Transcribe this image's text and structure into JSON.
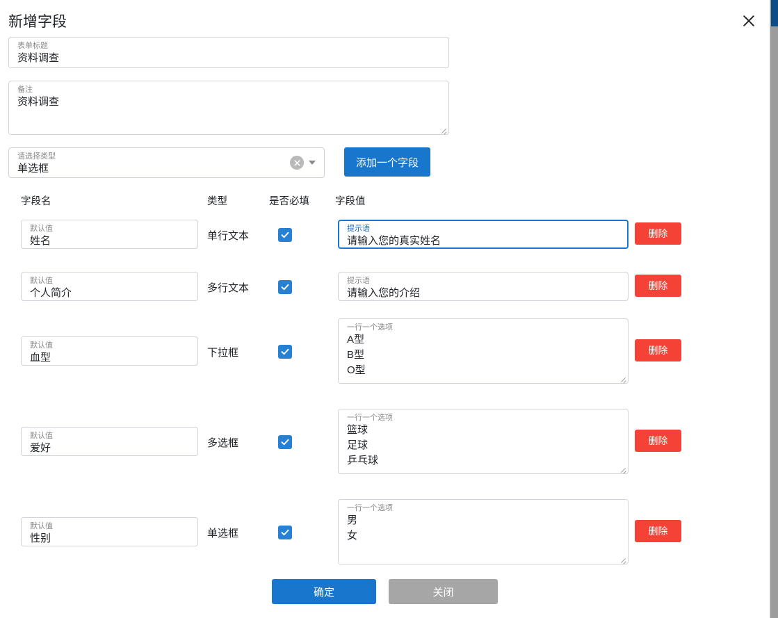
{
  "dialog": {
    "title": "新增字段",
    "close_icon": "close-icon"
  },
  "form": {
    "title_field": {
      "label": "表单标题",
      "value": "资料调查"
    },
    "remark_field": {
      "label": "备注",
      "value": "资料调查"
    },
    "type_select": {
      "label": "请选择类型",
      "value": "单选框",
      "clear_icon": "clear-circle-icon",
      "caret_icon": "chevron-down-icon"
    },
    "add_field_button": "添加一个字段"
  },
  "table": {
    "headers": {
      "name": "字段名",
      "type": "类型",
      "required": "是否必填",
      "value": "字段值"
    },
    "rows": [
      {
        "name_label": "默认值",
        "name_value": "姓名",
        "type": "单行文本",
        "required": true,
        "value_label": "提示语",
        "value_value": "请输入您的真实姓名",
        "value_multiline": false,
        "value_focused": true,
        "delete_label": "删除"
      },
      {
        "name_label": "默认值",
        "name_value": "个人简介",
        "type": "多行文本",
        "required": true,
        "value_label": "提示语",
        "value_value": "请输入您的介绍",
        "value_multiline": false,
        "value_focused": false,
        "delete_label": "删除"
      },
      {
        "name_label": "默认值",
        "name_value": "血型",
        "type": "下拉框",
        "required": true,
        "value_label": "一行一个选项",
        "value_value": "A型\nB型\nO型",
        "value_multiline": true,
        "value_focused": false,
        "delete_label": "删除"
      },
      {
        "name_label": "默认值",
        "name_value": "爱好",
        "type": "多选框",
        "required": true,
        "value_label": "一行一个选项",
        "value_value": "篮球\n足球\n乒乓球",
        "value_multiline": true,
        "value_focused": false,
        "delete_label": "删除"
      },
      {
        "name_label": "默认值",
        "name_value": "性别",
        "type": "单选框",
        "required": true,
        "value_label": "一行一个选项",
        "value_value": "男\n女",
        "value_multiline": true,
        "value_focused": false,
        "delete_label": "删除"
      }
    ]
  },
  "footer": {
    "confirm_label": "确定",
    "close_label": "关闭"
  },
  "colors": {
    "primary": "#1877cc",
    "danger": "#f44336",
    "secondary": "#a6a6a6",
    "focus_border": "#1976d2",
    "checkbox": "#2680d4",
    "scroll_thumb": "#0d4c84"
  }
}
